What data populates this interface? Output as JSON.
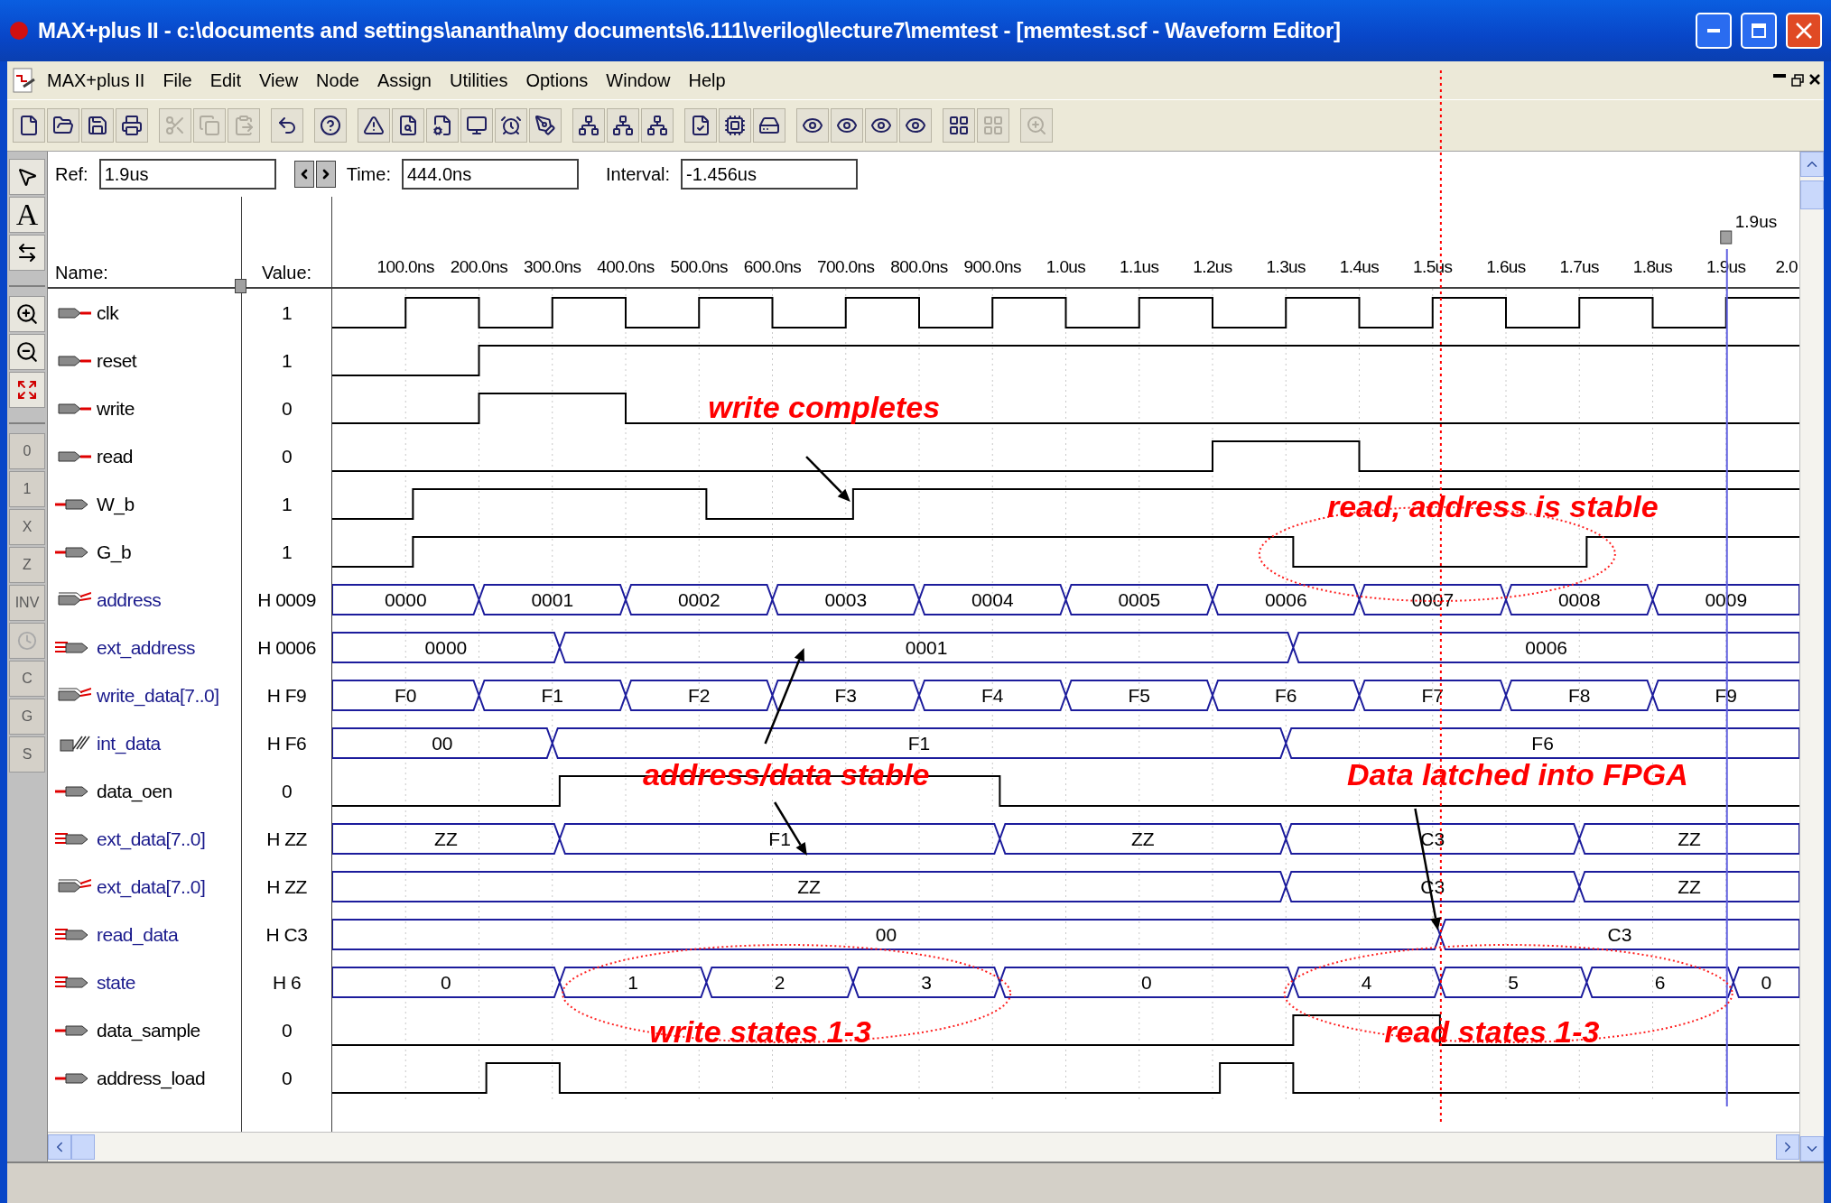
{
  "window": {
    "title": "MAX+plus II - c:\\documents and settings\\anantha\\my documents\\6.111\\verilog\\lecture7\\memtest - [memtest.scf - Waveform Editor]"
  },
  "menu": {
    "app_label": "MAX+plus II",
    "items": [
      "File",
      "Edit",
      "View",
      "Node",
      "Assign",
      "Utilities",
      "Options",
      "Window",
      "Help"
    ]
  },
  "toolbar": [
    {
      "disabled": false
    },
    {
      "disabled": false
    },
    {
      "disabled": false
    },
    {
      "disabled": false
    },
    {
      "disabled": true
    },
    {
      "disabled": true
    },
    {
      "disabled": true
    },
    {
      "disabled": false
    },
    {
      "disabled": false
    },
    {
      "disabled": false
    },
    {
      "disabled": false
    },
    {
      "disabled": false
    },
    {
      "disabled": false
    },
    {
      "disabled": false
    },
    {
      "disabled": false
    },
    {
      "disabled": false
    },
    {
      "disabled": false
    },
    {
      "disabled": false
    },
    {
      "disabled": false
    },
    {
      "disabled": false
    },
    {
      "disabled": false
    },
    {
      "disabled": false
    },
    {
      "disabled": false
    },
    {
      "disabled": false
    },
    {
      "disabled": false
    },
    {
      "disabled": false
    },
    {
      "disabled": true
    },
    {
      "disabled": true
    }
  ],
  "palette": [
    {
      "kind": "pointer",
      "disabled": false
    },
    {
      "kind": "text",
      "label": "A",
      "disabled": false
    },
    {
      "kind": "snap",
      "disabled": false
    },
    {
      "kind": "zoom_in",
      "disabled": false
    },
    {
      "kind": "zoom_out",
      "disabled": false
    },
    {
      "kind": "fit",
      "disabled": false
    },
    {
      "kind": "label",
      "label": "0",
      "disabled": true
    },
    {
      "kind": "label",
      "label": "1",
      "disabled": true
    },
    {
      "kind": "label",
      "label": "X",
      "disabled": true
    },
    {
      "kind": "label",
      "label": "Z",
      "disabled": true
    },
    {
      "kind": "label",
      "label": "INV",
      "disabled": true
    },
    {
      "kind": "clock",
      "disabled": true
    },
    {
      "kind": "label",
      "label": "C",
      "disabled": true
    },
    {
      "kind": "label",
      "label": "G",
      "disabled": true
    },
    {
      "kind": "label",
      "label": "S",
      "disabled": true
    }
  ],
  "time_bar": {
    "ref_label": "Ref:",
    "ref": "1.9us",
    "time_label": "Time:",
    "time": "444.0ns",
    "interval_label": "Interval:",
    "interval": "-1.456us"
  },
  "columns": {
    "name": "Name:",
    "value": "Value:"
  },
  "ruler": {
    "ticks": [
      "100.0ns",
      "200.0ns",
      "300.0ns",
      "400.0ns",
      "500.0ns",
      "600.0ns",
      "700.0ns",
      "800.0ns",
      "900.0ns",
      "1.0us",
      "1.1us",
      "1.2us",
      "1.3us",
      "1.4us",
      "1.5us",
      "1.6us",
      "1.7us",
      "1.8us",
      "1.9us",
      "2.0"
    ],
    "ref_marker": "1.9us"
  },
  "signals": [
    {
      "name": "clk",
      "value": "1",
      "kind": "input"
    },
    {
      "name": "reset",
      "value": "1",
      "kind": "input"
    },
    {
      "name": "write",
      "value": "0",
      "kind": "input"
    },
    {
      "name": "read",
      "value": "0",
      "kind": "input"
    },
    {
      "name": "W_b",
      "value": "1",
      "kind": "output"
    },
    {
      "name": "G_b",
      "value": "1",
      "kind": "output"
    },
    {
      "name": "address",
      "value": "H 0009",
      "kind": "bus_input",
      "segments": [
        "0000",
        "0001",
        "0002",
        "0003",
        "0004",
        "0005",
        "0006",
        "0007",
        "0008",
        "0009"
      ]
    },
    {
      "name": "ext_address",
      "value": "H 0006",
      "kind": "bus_output",
      "segments": [
        "0000",
        "0001",
        "0006"
      ]
    },
    {
      "name": "write_data[7..0]",
      "value": "H F9",
      "kind": "bus_input",
      "segments": [
        "F0",
        "F1",
        "F2",
        "F3",
        "F4",
        "F5",
        "F6",
        "F7",
        "F8",
        "F9"
      ]
    },
    {
      "name": "int_data",
      "value": "H F6",
      "kind": "buried",
      "segments": [
        "00",
        "F1",
        "F6"
      ]
    },
    {
      "name": "data_oen",
      "value": "0",
      "kind": "output"
    },
    {
      "name": "ext_data[7..0]",
      "value": "H ZZ",
      "kind": "bus_output",
      "segments": [
        "ZZ",
        "F1",
        "ZZ",
        "C3",
        "ZZ"
      ]
    },
    {
      "name": "ext_data[7..0]",
      "value": "H ZZ",
      "kind": "bus_input",
      "segments": [
        "ZZ",
        "C3",
        "ZZ"
      ]
    },
    {
      "name": "read_data",
      "value": "H C3",
      "kind": "bus_output",
      "segments": [
        "00",
        "C3"
      ]
    },
    {
      "name": "state",
      "value": "H 6",
      "kind": "bus_output",
      "segments": [
        "0",
        "1",
        "2",
        "3",
        "0",
        "4",
        "5",
        "6",
        "0"
      ]
    },
    {
      "name": "data_sample",
      "value": "0",
      "kind": "output"
    },
    {
      "name": "address_load",
      "value": "0",
      "kind": "output"
    }
  ],
  "annotations": [
    "write completes",
    "read, address is stable",
    "address/data stable",
    "Data latched into FPGA",
    "write states 1-3",
    "read states 1-3"
  ]
}
